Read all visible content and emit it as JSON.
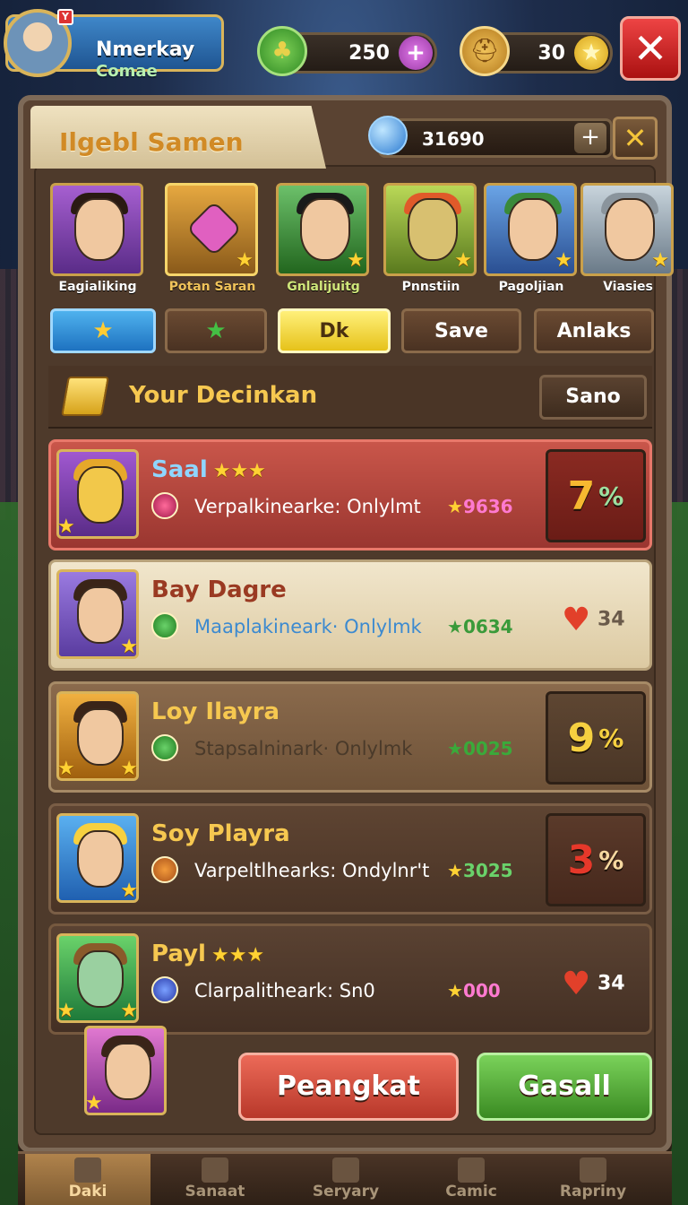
{
  "profile": {
    "name": "Nmerkay",
    "subtitle": "Comae",
    "badge": "Y"
  },
  "resources": [
    {
      "icon": "clover-icon",
      "value": "250"
    },
    {
      "icon": "helmet-icon",
      "value": "30"
    }
  ],
  "panel": {
    "title": "Ilgebl Samen",
    "gems": "31690"
  },
  "heroes": [
    {
      "label": "Eagialiking"
    },
    {
      "label": "Potan Saran"
    },
    {
      "label": "Gnlalijuitg"
    },
    {
      "label": "Pnnstiin"
    },
    {
      "label": "Pagoljian"
    },
    {
      "label": "Viasies"
    }
  ],
  "tabs": {
    "star1": "★",
    "star2": "★",
    "dk": "Dk",
    "save": "Save",
    "anlaks": "Anlaks"
  },
  "section": {
    "title": "Your Decinkan",
    "button": "Sano"
  },
  "rows": [
    {
      "name": "Saal",
      "stars": "★★★",
      "desc": "Verpalkinearke: Onlylmt",
      "score": "9636",
      "percent": "7",
      "pct_sign": "%"
    },
    {
      "name": "Bay Dagre",
      "stars": "",
      "desc": "Maaplakineark· Onlylmk",
      "score": "0634",
      "likes": "34"
    },
    {
      "name": "Loy Ilayra",
      "stars": "",
      "desc": "Stapsalninark· Onlylmk",
      "score": "0025",
      "percent": "9",
      "pct_sign": "%"
    },
    {
      "name": "Soy Playra",
      "stars": "",
      "desc": "Varpeltlhearks: Ondylnr't",
      "score": "3025",
      "percent": "3",
      "pct_sign": "%"
    },
    {
      "name": "Payl",
      "stars": "★★★",
      "desc": "Clarpalitheark: Sn0",
      "score": "000",
      "likes": "34"
    }
  ],
  "actions": {
    "red": "Peangkat",
    "green": "Gasall"
  },
  "nav": [
    {
      "label": "Daki",
      "active": true
    },
    {
      "label": "Sanaat"
    },
    {
      "label": "Seryary"
    },
    {
      "label": "Camic"
    },
    {
      "label": "Rapriny"
    }
  ],
  "colors": {
    "accent_gold": "#f6c850",
    "panel_brown": "#5a4332",
    "red_button": "#d04a3a",
    "green_button": "#5ab03a"
  }
}
